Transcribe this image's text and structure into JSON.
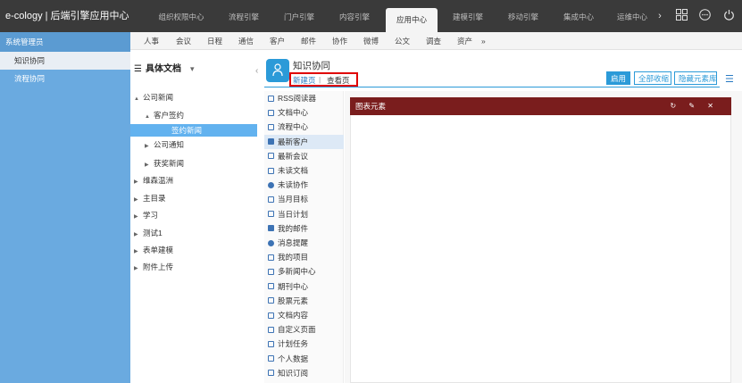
{
  "app": {
    "title": "e-cology | 后端引擎应用中心"
  },
  "top_tabs": [
    "组织权限中心",
    "流程引擎",
    "门户引擎",
    "内容引擎",
    "应用中心",
    "建模引擎",
    "移动引擎",
    "集成中心",
    "运维中心"
  ],
  "top_active": "应用中心",
  "top_icons": [
    "chevron-right-icon",
    "grid-icon",
    "more-icon",
    "power-icon"
  ],
  "sidebar": {
    "user": "系统管理员",
    "items": [
      "知识协同",
      "流程协同"
    ],
    "active": "知识协同"
  },
  "subnav": [
    "人事",
    "会议",
    "日程",
    "通信",
    "客户",
    "邮件",
    "协作",
    "微博",
    "公文",
    "调查",
    "资产",
    "»"
  ],
  "tree": {
    "header": "具体文档",
    "nodes": [
      {
        "label": "公司新闻",
        "level": 0,
        "arrow": "▲"
      },
      {
        "label": "客户签约",
        "level": 1,
        "arrow": "▲"
      },
      {
        "label": "签约新闻",
        "level": 2,
        "arrow": "",
        "selected": true
      },
      {
        "label": "公司通知",
        "level": 1,
        "arrow": "▶"
      },
      {
        "label": "获奖新闻",
        "level": 1,
        "arrow": "▶"
      },
      {
        "label": "维森温洲",
        "level": 0,
        "arrow": "▶"
      },
      {
        "label": "主目录",
        "level": 0,
        "arrow": "▶"
      },
      {
        "label": "学习",
        "level": 0,
        "arrow": "▶"
      },
      {
        "label": "测试1",
        "level": 0,
        "arrow": "▶"
      },
      {
        "label": "表单建模",
        "level": 0,
        "arrow": "▶"
      },
      {
        "label": "附件上传",
        "level": 0,
        "arrow": "▶"
      }
    ]
  },
  "page": {
    "title": "知识协同",
    "tab_new": "新建页",
    "tab_sep": "|",
    "tab_view": "查看页"
  },
  "actions": {
    "enable": "启用",
    "collapse_all": "全部收缩",
    "hide_library": "隐藏元素库"
  },
  "elements": [
    "RSS阅读器",
    "文档中心",
    "流程中心",
    "最新客户",
    "最新会议",
    "未读文档",
    "未读协作",
    "当月目标",
    "当日计划",
    "我的邮件",
    "消息提醒",
    "我的项目",
    "多新闻中心",
    "期刊中心",
    "股票元素",
    "文档内容",
    "自定义页面",
    "计划任务",
    "个人数据",
    "知识订阅"
  ],
  "elements_highlight": "最新客户",
  "portlet": {
    "title": "图表元素",
    "tools": "↻ ✎ ✕"
  },
  "colors": {
    "topbar": "#3a3a3a",
    "sidebar": "#6aaae0",
    "accent": "#2b9ad8",
    "portlet_head": "#7a1d1d",
    "highlight": "#e00000"
  }
}
